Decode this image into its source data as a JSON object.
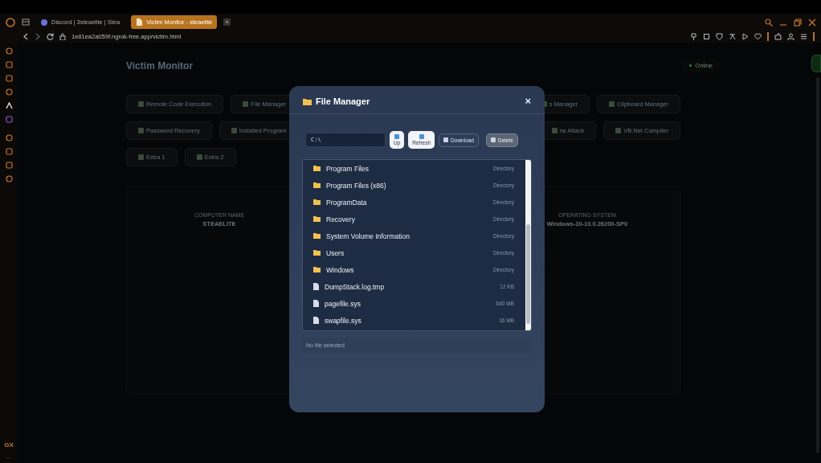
{
  "browser": {
    "tabs": [
      {
        "title": "Discord | 3steaelite | Stea",
        "selected": false
      },
      {
        "title": "Victim Monitor - steaelite",
        "selected": true
      }
    ],
    "new_tab": "+",
    "url": "1e81ea2a059f.ngrok-free.app/victim.html",
    "sidebar_badge": "GX",
    "sidebar_more": "..."
  },
  "page": {
    "title": "Victim Monitor",
    "status": "Online",
    "action_rows": [
      {
        "left": [
          "Remote Code Execution",
          "File Manager"
        ],
        "right": [
          "s Manager",
          "Clipboard Manager"
        ]
      },
      {
        "left": [
          "Password Recovery",
          "Installed Program"
        ],
        "right": [
          "ns Attack",
          "VB.Net Compiler"
        ]
      },
      {
        "left": [
          "Extra 1",
          "Extra 2"
        ],
        "right": []
      }
    ],
    "info": [
      {
        "label": "COMPUTER NAME",
        "value": "STEAELITE"
      },
      {
        "label": "OPERATING SYSTEM",
        "value": "Windows-10-10.0.26200-SP0"
      }
    ]
  },
  "file_manager": {
    "title": "File Manager",
    "close": "×",
    "path": "C:\\",
    "buttons": [
      {
        "label": "Up",
        "kind": "light"
      },
      {
        "label": "Refresh",
        "kind": "light"
      },
      {
        "label": "Download",
        "kind": "dark"
      },
      {
        "label": "Delete",
        "kind": "grey"
      }
    ],
    "entries": [
      {
        "name": "Program Files",
        "kind": "folder",
        "detail": "Directory"
      },
      {
        "name": "Program Files (x86)",
        "kind": "folder",
        "detail": "Directory"
      },
      {
        "name": "ProgramData",
        "kind": "folder",
        "detail": "Directory"
      },
      {
        "name": "Recovery",
        "kind": "folder",
        "detail": "Directory"
      },
      {
        "name": "System Volume Information",
        "kind": "folder",
        "detail": "Directory"
      },
      {
        "name": "Users",
        "kind": "folder",
        "detail": "Directory"
      },
      {
        "name": "Windows",
        "kind": "folder",
        "detail": "Directory"
      },
      {
        "name": "DumpStack.log.tmp",
        "kind": "file",
        "detail": "12 KB"
      },
      {
        "name": "pagefile.sys",
        "kind": "file",
        "detail": "640 MB"
      },
      {
        "name": "swapfile.sys",
        "kind": "file",
        "detail": "16 MB"
      }
    ],
    "status": "No file selected"
  }
}
